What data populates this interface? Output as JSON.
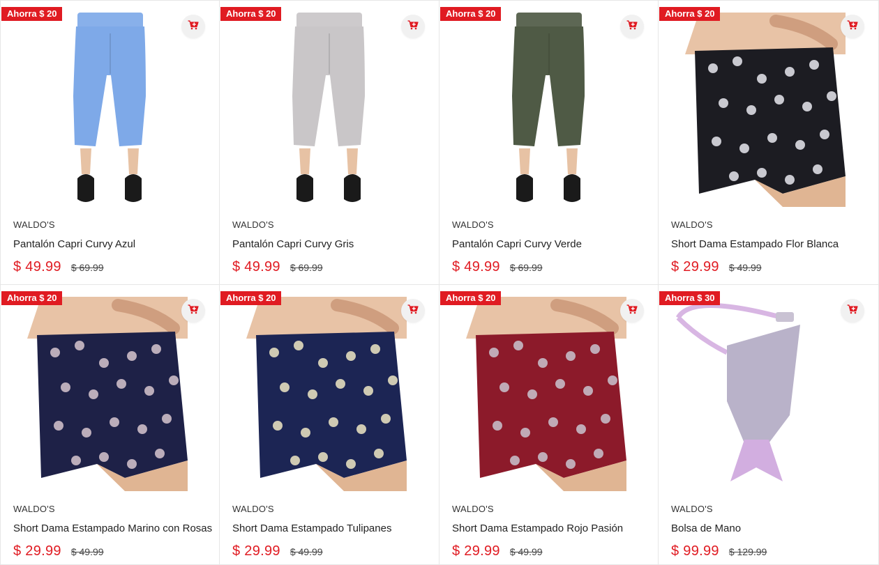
{
  "colors": {
    "accent": "#e01b22",
    "badge_text": "#ffffff",
    "cart_bg": "#f1f1f1"
  },
  "products": [
    {
      "badge": "Ahorra $ 20",
      "brand": "WALDO'S",
      "name": "Pantalón Capri Curvy Azul",
      "price": "$ 49.99",
      "old_price": "$ 69.99",
      "image": {
        "kind": "capri",
        "color": "#7ea9e8",
        "shoe": "#1a1a1a"
      }
    },
    {
      "badge": "Ahorra $ 20",
      "brand": "WALDO'S",
      "name": "Pantalón Capri Curvy Gris",
      "price": "$ 49.99",
      "old_price": "$ 69.99",
      "image": {
        "kind": "capri",
        "color": "#c9c6c8",
        "shoe": "#1a1a1a"
      }
    },
    {
      "badge": "Ahorra $ 20",
      "brand": "WALDO'S",
      "name": "Pantalón Capri Curvy Verde",
      "price": "$ 49.99",
      "old_price": "$ 69.99",
      "image": {
        "kind": "capri",
        "color": "#4f5a45",
        "shoe": "#1a1a1a"
      }
    },
    {
      "badge": "Ahorra $ 20",
      "brand": "WALDO'S",
      "name": "Short Dama Estampado Flor Blanca",
      "price": "$ 29.99",
      "old_price": "$ 49.99",
      "image": {
        "kind": "short",
        "color": "#1c1c22",
        "pattern": "#e8e8ee"
      }
    },
    {
      "badge": "Ahorra $ 20",
      "brand": "WALDO'S",
      "name": "Short Dama Estampado Marino con Rosas",
      "price": "$ 29.99",
      "old_price": "$ 49.99",
      "image": {
        "kind": "short",
        "color": "#1e2147",
        "pattern": "#d7c6cf"
      }
    },
    {
      "badge": "Ahorra $ 20",
      "brand": "WALDO'S",
      "name": "Short Dama Estampado Tulipanes",
      "price": "$ 29.99",
      "old_price": "$ 49.99",
      "image": {
        "kind": "short",
        "color": "#1c2554",
        "pattern": "#efe8c4"
      }
    },
    {
      "badge": "Ahorra $ 20",
      "brand": "WALDO'S",
      "name": "Short Dama Estampado Rojo Pasión",
      "price": "$ 29.99",
      "old_price": "$ 49.99",
      "image": {
        "kind": "short",
        "color": "#8c1a2a",
        "pattern": "#c9c4cf"
      }
    },
    {
      "badge": "Ahorra $ 30",
      "brand": "WALDO'S",
      "name": "Bolsa de Mano",
      "price": "$ 99.99",
      "old_price": "$ 129.99",
      "image": {
        "kind": "bag",
        "color": "#b9b2c9",
        "strap": "#d8b6e3"
      }
    }
  ]
}
